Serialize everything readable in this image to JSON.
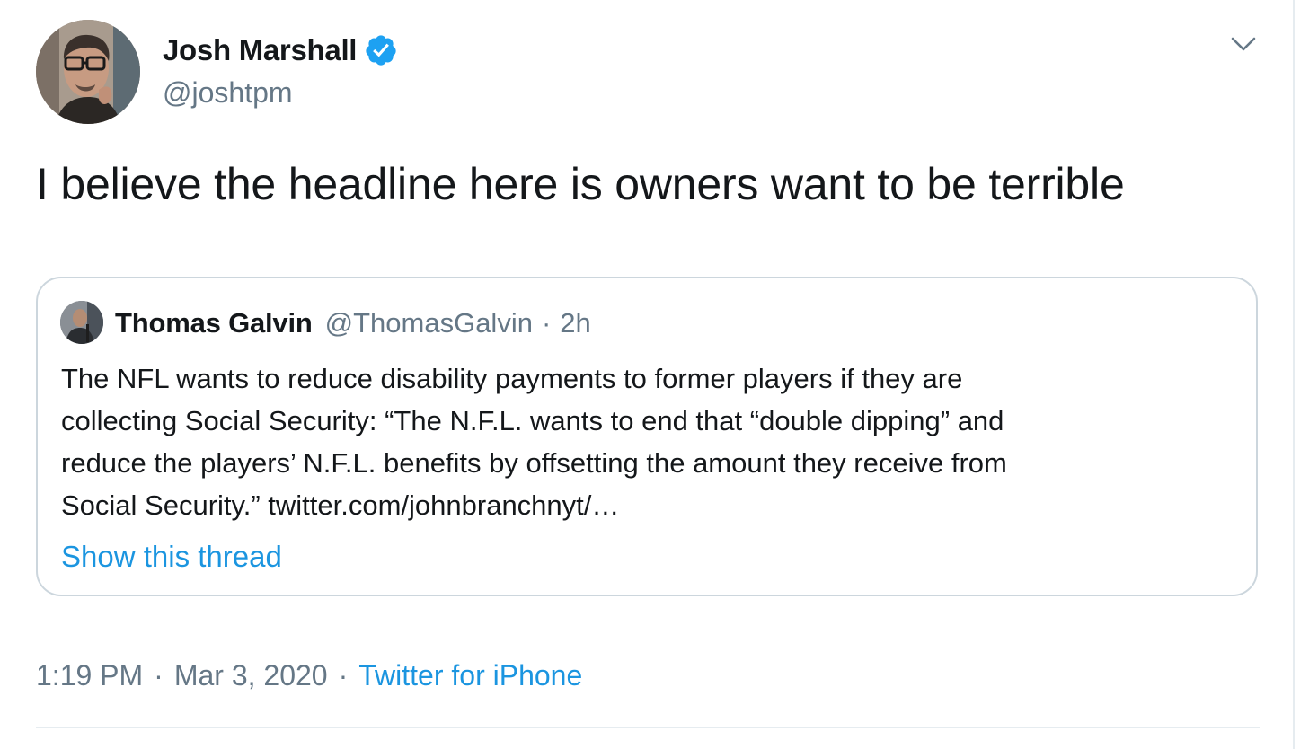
{
  "tweet": {
    "author": {
      "name": "Josh Marshall",
      "handle": "@joshtpm",
      "verified": true,
      "avatar_icon": "profile-photo"
    },
    "menu_icon": "chevron-down-icon",
    "text": "I believe the headline here is owners want to be terrible",
    "quoted": {
      "author_name": "Thomas Galvin",
      "author_handle": "@ThomasGalvin",
      "separator": "·",
      "time": "2h",
      "text_lines": [
        "The NFL wants to reduce disability payments to former players if they are",
        "collecting Social Security: “The N.F.L. wants to end that “double dipping” and",
        "reduce the players’ N.F.L. benefits by offsetting the amount they receive from",
        "Social Security.” twitter.com/johnbranchnyt/…"
      ],
      "show_thread_label": "Show this thread"
    },
    "meta": {
      "time": "1:19 PM",
      "separator": "·",
      "date": "Mar 3, 2020",
      "source": "Twitter for iPhone"
    }
  },
  "colors": {
    "text_primary": "#14171a",
    "text_secondary": "#657786",
    "link": "#1b95e0",
    "verified_badge": "#1da1f2",
    "border": "#ccd6dd",
    "divider": "#e6ecf0"
  }
}
